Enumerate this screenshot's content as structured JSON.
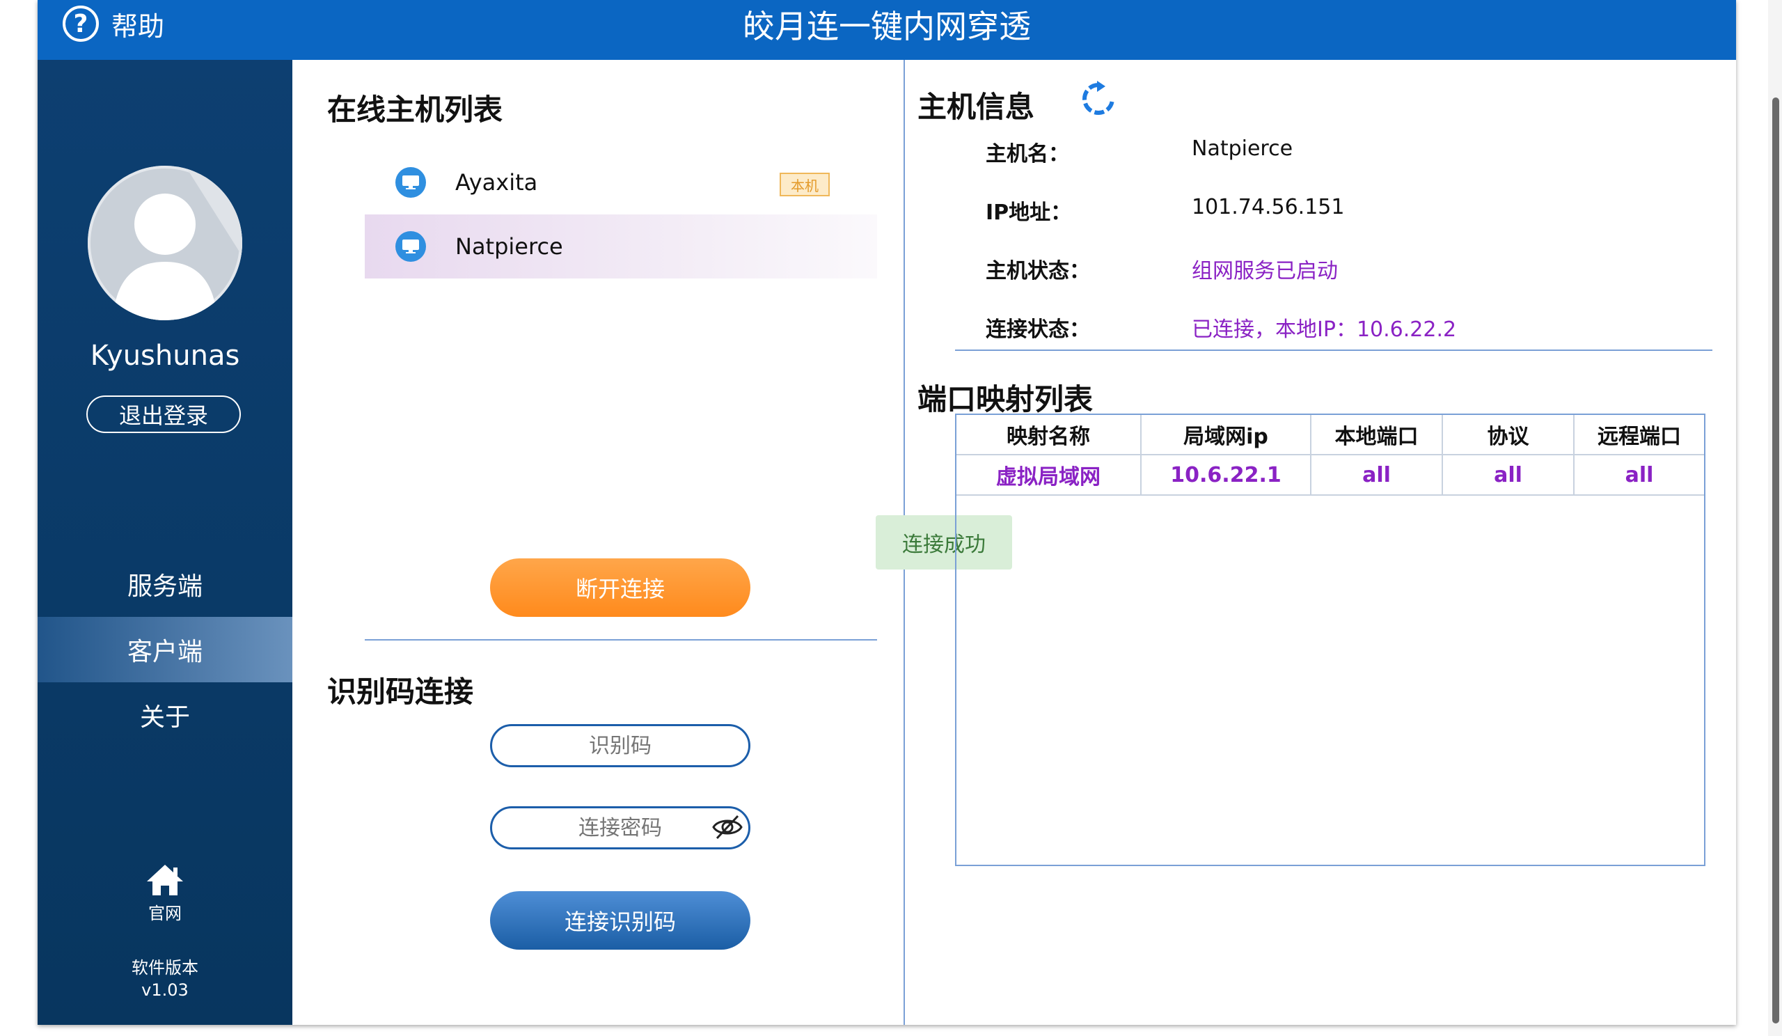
{
  "titlebar": {
    "help_label": "帮助",
    "help_icon": "question-circle-icon",
    "app_title": "皎月连一键内网穿透"
  },
  "sidebar": {
    "username": "Kyushunas",
    "logout_label": "退出登录",
    "nav": [
      {
        "label": "服务端",
        "active": false
      },
      {
        "label": "客户端",
        "active": true
      },
      {
        "label": "关于",
        "active": false
      }
    ],
    "home_label": "官网",
    "home_icon": "home-icon",
    "version_label": "软件版本",
    "version": "v1.03"
  },
  "hosts": {
    "title": "在线主机列表",
    "items": [
      {
        "name": "Ayaxita",
        "badge": "本机",
        "selected": false
      },
      {
        "name": "Natpierce",
        "badge": "",
        "selected": true
      }
    ],
    "disconnect_label": "断开连接"
  },
  "code_connect": {
    "title": "识别码连接",
    "code_placeholder": "识别码",
    "password_placeholder": "连接密码",
    "connect_label": "连接识别码"
  },
  "toast": {
    "text": "连接成功",
    "color": "#d9eed8"
  },
  "host_info": {
    "title": "主机信息",
    "refresh_icon": "refresh-icon",
    "rows": [
      {
        "label": "主机名：",
        "value": "Natpierce"
      },
      {
        "label": "IP地址：",
        "value": "101.74.56.151"
      },
      {
        "label": "主机状态：",
        "value": "组网服务已启动"
      },
      {
        "label": "连接状态：",
        "value": "已连接，本地IP：10.6.22.2"
      }
    ]
  },
  "port_map": {
    "title": "端口映射列表",
    "headers": [
      "映射名称",
      "局域网ip",
      "本地端口",
      "协议",
      "远程端口"
    ],
    "rows": [
      [
        "虚拟局域网",
        "10.6.22.1",
        "all",
        "all",
        "all"
      ]
    ]
  },
  "colors": {
    "titlebar": "#0b66c2",
    "sidebar": "#0d3f71",
    "accent_purple": "#8a22c4",
    "orange": "#ff8a1c",
    "blue_button": "#1b5ea5"
  }
}
